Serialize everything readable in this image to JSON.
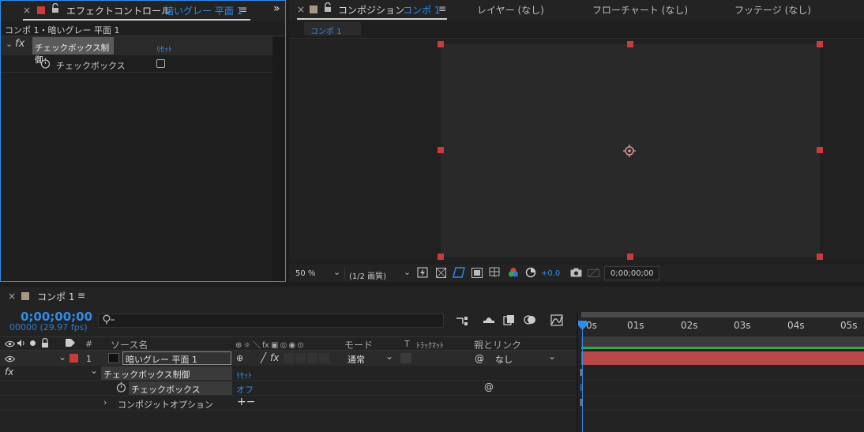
{
  "effect_panel": {
    "close": "×",
    "title": "エフェクトコントロール",
    "layer": "暗いグレー 平面 1",
    "menu": "≡",
    "expand": "»",
    "breadcrumb": "コンポ 1・暗いグレー 平面 1",
    "fx_label": "fx",
    "effect_name": "チェックボックス制御",
    "reset": "ﾘｾｯﾄ",
    "param_label": "チェックボックス"
  },
  "comp_panel": {
    "close": "×",
    "title": "コンポジション",
    "comp_name": "コンポ 1",
    "menu": "≡",
    "tabs": [
      "レイヤー (なし)",
      "フローチャート (なし)",
      "フッテージ (なし)"
    ],
    "sub_tab": "コンポ 1",
    "zoom": "50 %",
    "resolution": "(1/2 画質)",
    "exposure": "+0.0",
    "timecode": "0;00;00;00"
  },
  "timeline": {
    "close": "×",
    "tab": "コンポ 1",
    "menu": "≡",
    "current_time": "0;00;00;00",
    "frame_info": "00000 (29.97 fps)",
    "search_icon": "ρ‧",
    "headers": {
      "hash": "#",
      "source": "ソース名",
      "switches": "⊕ ☼ ＼ fx ▣ ◎ ◉ ⊙",
      "mode": "モード",
      "t": "T",
      "trackmatte": "ﾄﾗｯｸﾏｯﾄ",
      "parent": "親とリンク"
    },
    "ruler": [
      "0s",
      "01s",
      "02s",
      "03s",
      "04s",
      "05s"
    ],
    "layer": {
      "num": "1",
      "name": "暗いグレー 平面 1",
      "mode": "通常",
      "parent": "なし"
    },
    "fx_row": {
      "fx": "fx",
      "effect": "チェックボックス制御",
      "reset": "ﾘｾｯﾄ"
    },
    "param_row": {
      "label": "チェックボックス",
      "value": "オフ"
    },
    "composite_row": {
      "label": "コンポジットオプション",
      "plusminus": "+−"
    }
  },
  "colors": {
    "accent": "#2d8ceb",
    "layer_label": "#c83c3c",
    "layer_bar": "#b84848",
    "work_area": "#2fa84f"
  }
}
